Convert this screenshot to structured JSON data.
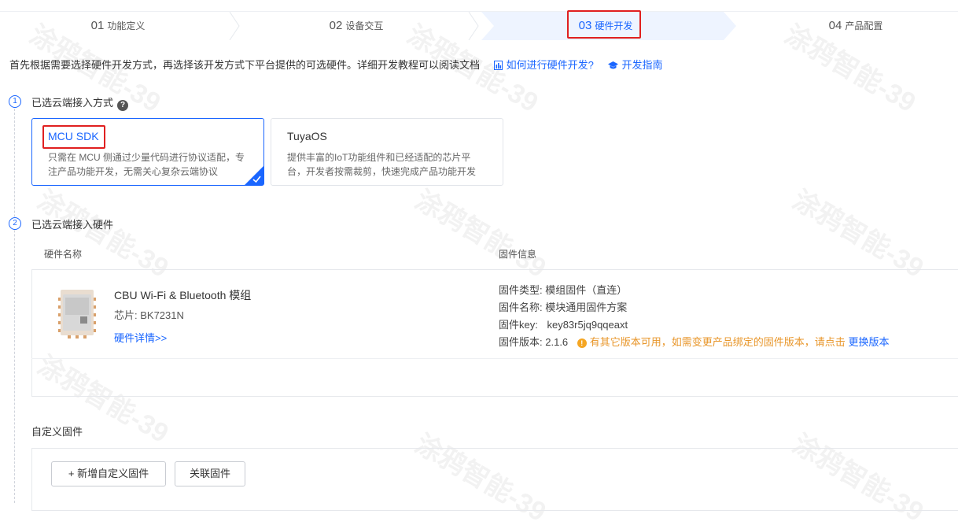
{
  "steps": [
    {
      "num": "01",
      "label": "功能定义"
    },
    {
      "num": "02",
      "label": "设备交互"
    },
    {
      "num": "03",
      "label": "硬件开发"
    },
    {
      "num": "04",
      "label": "产品配置"
    }
  ],
  "intro": {
    "text": "首先根据需要选择硬件开发方式，再选择该开发方式下平台提供的可选硬件。详细开发教程可以阅读文档",
    "link1": "如何进行硬件开发?",
    "link2": "开发指南"
  },
  "section1": {
    "num": "1",
    "title": "已选云端接入方式",
    "help": "?"
  },
  "cards": [
    {
      "title": "MCU SDK",
      "desc": "只需在 MCU 侧通过少量代码进行协议适配，专注产品功能开发，无需关心复杂云端协议"
    },
    {
      "title": "TuyaOS",
      "desc": "提供丰富的IoT功能组件和已经适配的芯片平台，开发者按需裁剪，快速完成产品功能开发"
    }
  ],
  "section2": {
    "num": "2",
    "title": "已选云端接入硬件"
  },
  "table": {
    "col_hw": "硬件名称",
    "col_fw": "固件信息"
  },
  "hardware": {
    "name": "CBU Wi-Fi & Bluetooth 模组",
    "chip": "芯片: BK7231N",
    "details": "硬件详情>>"
  },
  "firmware": {
    "type_label": "固件类型:",
    "type_value": "模组固件（直连）",
    "name_label": "固件名称:",
    "name_value": "模块通用固件方案",
    "key_label": "固件key:",
    "key_value": "key83r5jq9qqeaxt",
    "ver_label": "固件版本:",
    "ver_value": "2.1.6",
    "warning": "有其它版本可用，如需变更产品绑定的固件版本，请点击",
    "change": "更换版本"
  },
  "custom": {
    "title": "自定义固件",
    "add_btn": "+ 新增自定义固件",
    "link_btn": "关联固件"
  },
  "watermark": "涂鸦智能-39",
  "colors": {
    "accent": "#1a66ff",
    "warning": "#e8962a",
    "highlight": "#e02020"
  },
  "icons": [
    "doc-icon",
    "graduation-cap-icon",
    "check-icon",
    "help-icon",
    "warning-icon"
  ]
}
